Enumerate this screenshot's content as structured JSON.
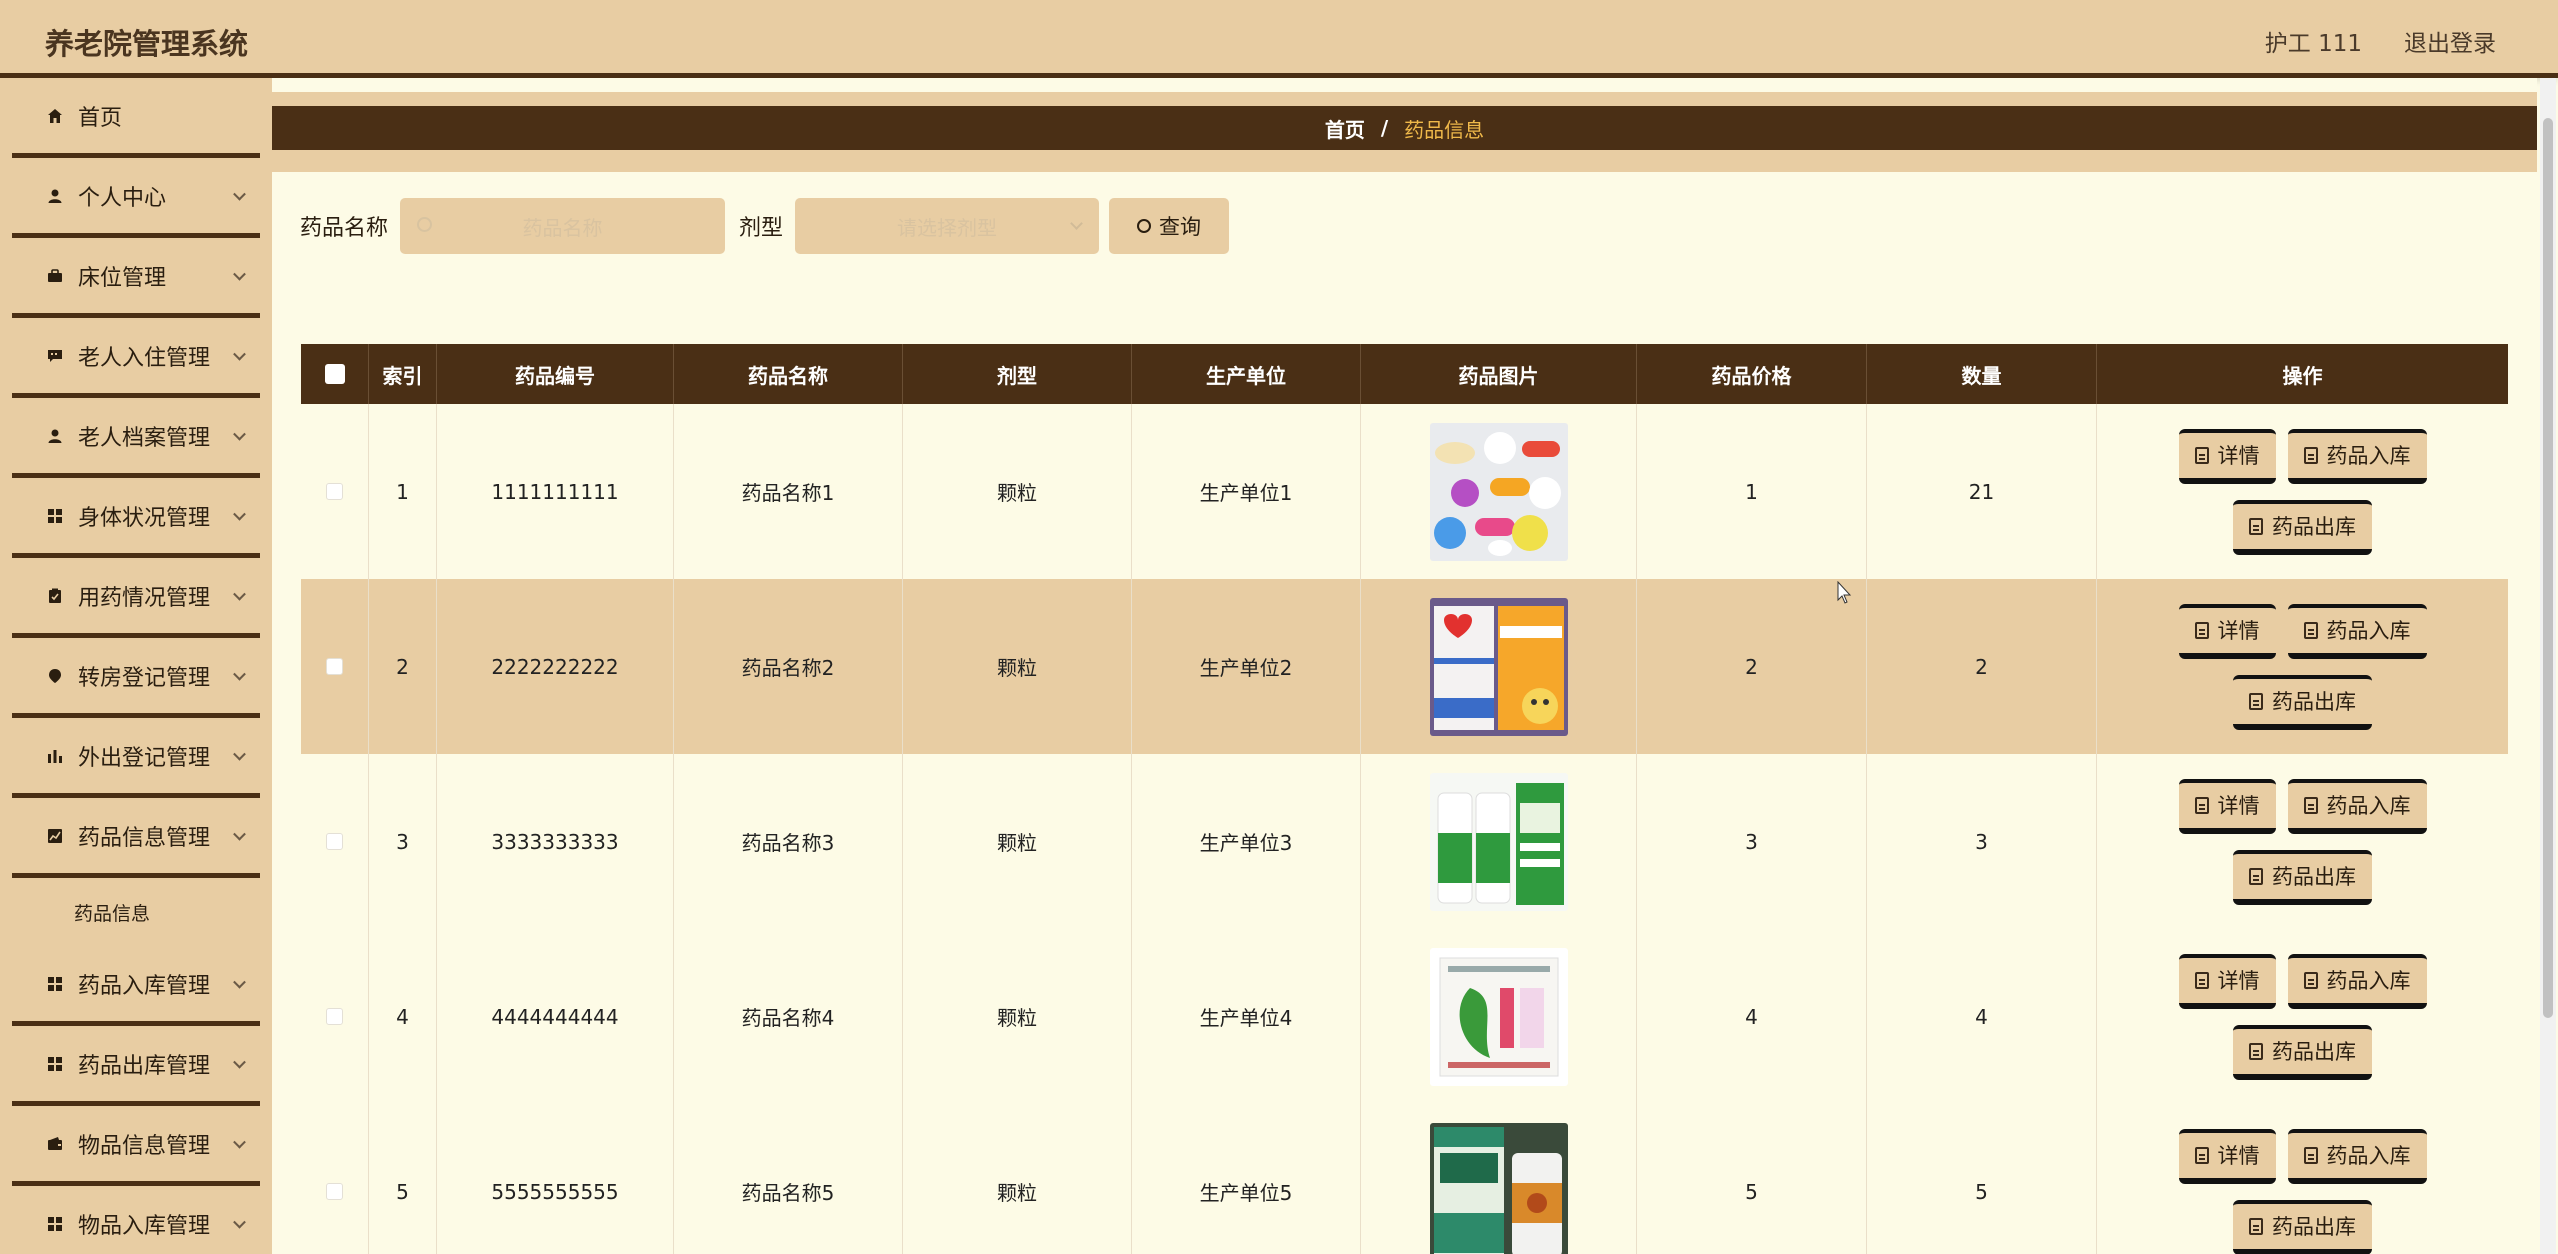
{
  "app": {
    "title": "养老院管理系统"
  },
  "user": {
    "name": "护工 111",
    "logout": "退出登录"
  },
  "sidebar": {
    "items": [
      {
        "label": "首页",
        "icon": "home-icon",
        "expandable": false
      },
      {
        "label": "个人中心",
        "icon": "user-icon",
        "expandable": true
      },
      {
        "label": "床位管理",
        "icon": "bed-icon",
        "expandable": true
      },
      {
        "label": "老人入住管理",
        "icon": "chat-icon",
        "expandable": true
      },
      {
        "label": "老人档案管理",
        "icon": "user-icon",
        "expandable": true
      },
      {
        "label": "身体状况管理",
        "icon": "grid-icon",
        "expandable": true
      },
      {
        "label": "用药情况管理",
        "icon": "clipboard-icon",
        "expandable": true
      },
      {
        "label": "转房登记管理",
        "icon": "pin-icon",
        "expandable": true
      },
      {
        "label": "外出登记管理",
        "icon": "bar-chart-icon",
        "expandable": true
      },
      {
        "label": "药品信息管理",
        "icon": "line-chart-icon",
        "expandable": true
      },
      {
        "label": "药品入库管理",
        "icon": "grid-icon",
        "expandable": true
      },
      {
        "label": "药品出库管理",
        "icon": "grid-icon",
        "expandable": true
      },
      {
        "label": "物品信息管理",
        "icon": "wallet-icon",
        "expandable": true
      },
      {
        "label": "物品入库管理",
        "icon": "grid-icon",
        "expandable": true
      }
    ],
    "submenu": {
      "label": "药品信息"
    }
  },
  "breadcrumb": {
    "home": "首页",
    "separator": "/",
    "current": "药品信息"
  },
  "search": {
    "name_label": "药品名称",
    "name_placeholder": "药品名称",
    "type_label": "剂型",
    "type_placeholder": "请选择剂型",
    "button_label": "查询"
  },
  "table": {
    "headers": [
      "索引",
      "药品编号",
      "药品名称",
      "剂型",
      "生产单位",
      "药品图片",
      "药品价格",
      "数量",
      "操作"
    ],
    "rows": [
      {
        "index": "1",
        "code": "1111111111",
        "name": "药品名称1",
        "type": "颗粒",
        "manufacturer": "生产单位1",
        "price": "1",
        "quantity": "21"
      },
      {
        "index": "2",
        "code": "2222222222",
        "name": "药品名称2",
        "type": "颗粒",
        "manufacturer": "生产单位2",
        "price": "2",
        "quantity": "2"
      },
      {
        "index": "3",
        "code": "3333333333",
        "name": "药品名称3",
        "type": "颗粒",
        "manufacturer": "生产单位3",
        "price": "3",
        "quantity": "3"
      },
      {
        "index": "4",
        "code": "4444444444",
        "name": "药品名称4",
        "type": "颗粒",
        "manufacturer": "生产单位4",
        "price": "4",
        "quantity": "4"
      },
      {
        "index": "5",
        "code": "5555555555",
        "name": "药品名称5",
        "type": "颗粒",
        "manufacturer": "生产单位5",
        "price": "5",
        "quantity": "5"
      }
    ],
    "actions": {
      "detail": "详情",
      "stock_in": "药品入库",
      "stock_out": "药品出库"
    }
  }
}
